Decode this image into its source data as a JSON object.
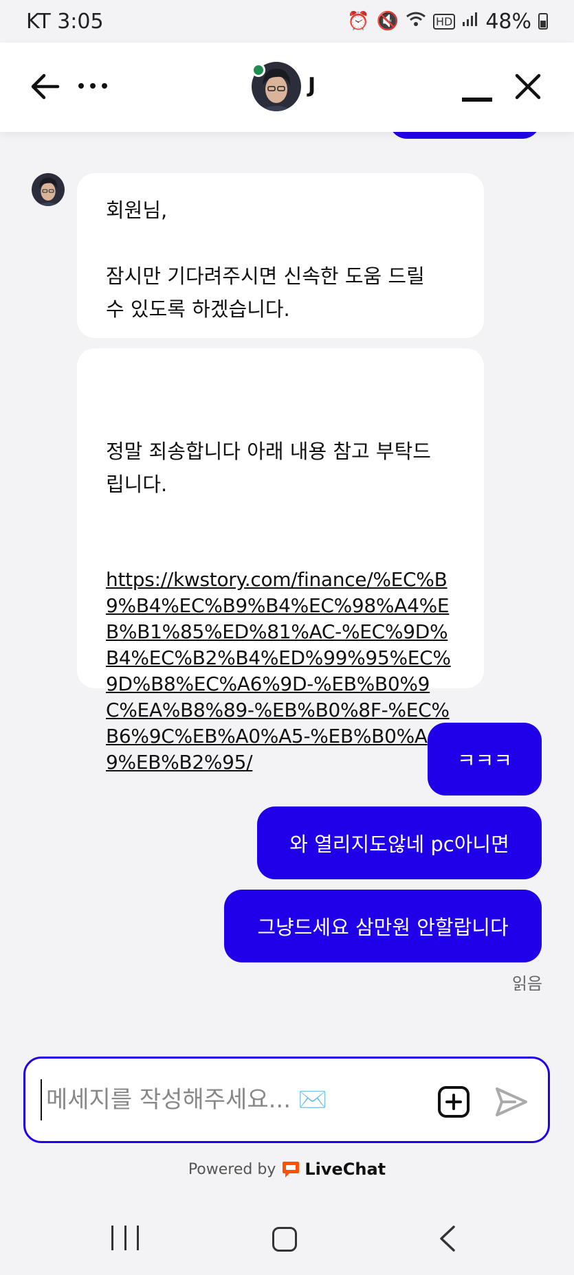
{
  "status_bar": {
    "time": "KT 3:05",
    "battery": "48%",
    "icons": [
      "alarm-icon",
      "mute-icon",
      "wifi-icon",
      "hd-icon",
      "signal-icon",
      "battery-icon"
    ]
  },
  "header": {
    "agent_name": "J",
    "online": true
  },
  "messages_in": [
    {
      "text": "회원님,\n\n잠시만 기다려주시면 신속한 도움 드릴\n수 있도록 하겠습니다."
    },
    {
      "text": "정말 죄송합니다 아래 내용 참고 부탁드\n립니다.",
      "link": "https://kwstory.com/finance/%EC%B9%B4%EC%B9%B4%EC%98%A4%EB%B1%85%ED%81%AC-%EC%9D%B4%EC%B2%B4%ED%99%95%EC%9D%B8%EC%A6%9D-%EB%B0%9C%EA%B8%89-%EB%B0%8F-%EC%B6%9C%EB%A0%A5-%EB%B0%A9%EB%B2%95/"
    }
  ],
  "messages_out": [
    {
      "text": "ㅋㅋㅋ"
    },
    {
      "text": "와 열리지도않네 pc아니면"
    },
    {
      "text": "그냥드세요 삼만원 안할랍니다"
    }
  ],
  "read_status": "읽음",
  "composer": {
    "placeholder": "메세지를 작성해주세요... ✉️"
  },
  "footer": {
    "powered_by": "Powered by",
    "brand": "LiveChat"
  },
  "colors": {
    "accent": "#2000e8",
    "online": "#1e8e50",
    "brand_orange": "#ff5100"
  }
}
